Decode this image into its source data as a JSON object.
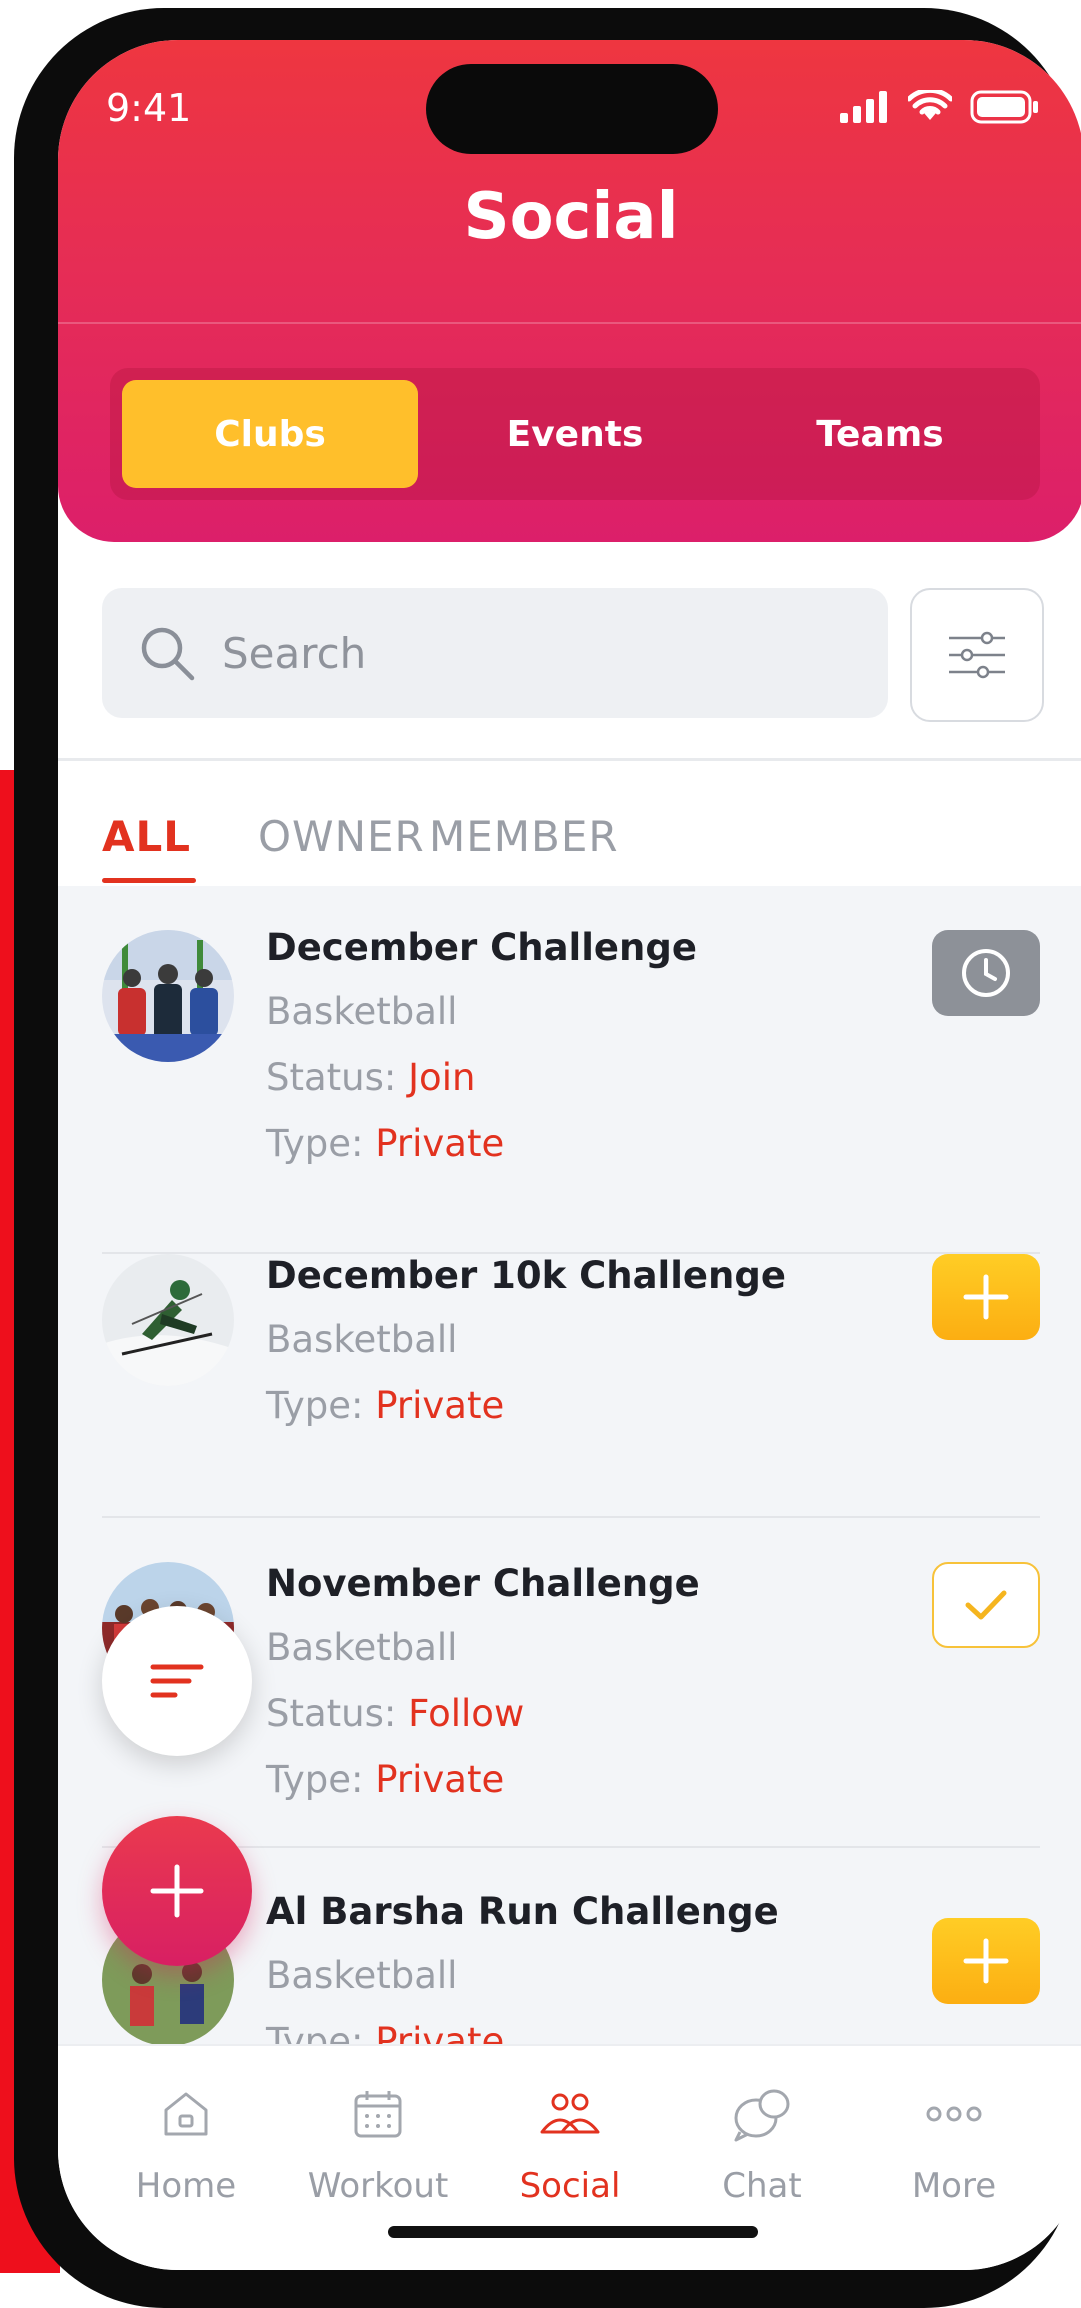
{
  "status": {
    "time": "9:41"
  },
  "header": {
    "title": "Social"
  },
  "segments": [
    {
      "label": "Clubs",
      "active": true
    },
    {
      "label": "Events",
      "active": false
    },
    {
      "label": "Teams",
      "active": false
    }
  ],
  "search": {
    "placeholder": "Search"
  },
  "subtabs": [
    {
      "label": "ALL",
      "active": true
    },
    {
      "label": "OWNER",
      "active": false
    },
    {
      "label": "MEMBER",
      "active": false
    }
  ],
  "items": [
    {
      "title": "December Challenge",
      "sport": "Basketball",
      "status_label": "Status:",
      "status_value": "Join",
      "type_label": "Type:",
      "type_value": "Private",
      "action": "clock-icon"
    },
    {
      "title": "December 10k Challenge",
      "sport": "Basketball",
      "type_label": "Type:",
      "type_value": "Private",
      "action": "plus-icon"
    },
    {
      "title": "November Challenge",
      "sport": "Basketball",
      "status_label": "Status:",
      "status_value": "Follow",
      "type_label": "Type:",
      "type_value": "Private",
      "action": "check-icon"
    },
    {
      "title": "Al Barsha Run Challenge",
      "sport": "Basketball",
      "type_label": "Type:",
      "type_value": "Private",
      "action": "plus-icon"
    }
  ],
  "nav": [
    {
      "label": "Home",
      "icon": "home-icon",
      "active": false
    },
    {
      "label": "Workout",
      "icon": "calendar-icon",
      "active": false
    },
    {
      "label": "Social",
      "icon": "people-icon",
      "active": true
    },
    {
      "label": "Chat",
      "icon": "chat-icon",
      "active": false
    },
    {
      "label": "More",
      "icon": "more-icon",
      "active": false
    }
  ],
  "colors": {
    "accent": "#e2321f",
    "brand_red": "#ee3640",
    "brand_pink": "#dc1f6a",
    "active_segment": "#ffbf2b",
    "action_yellow": "#fcae12"
  }
}
